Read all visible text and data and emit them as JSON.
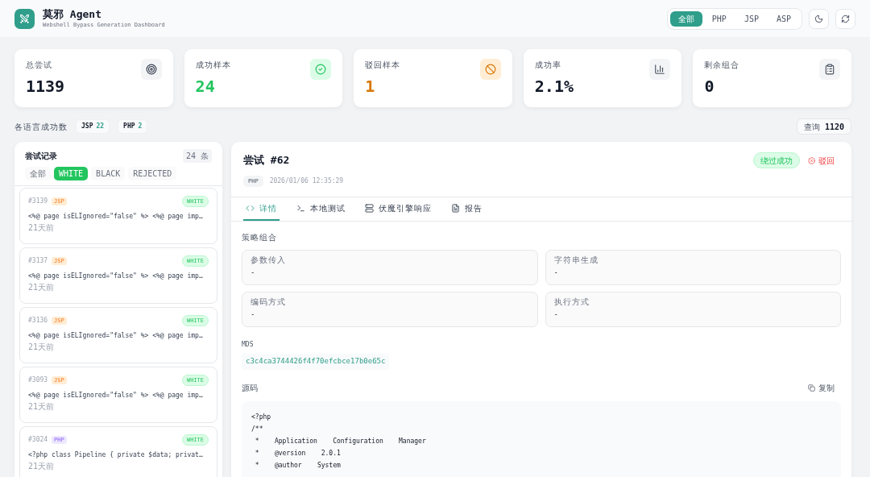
{
  "header": {
    "title": "莫邪 Agent",
    "subtitle": "Webshell Bypass Generation Dashboard",
    "languages": [
      {
        "label": "全部",
        "selected": true
      },
      {
        "label": "PHP",
        "selected": false
      },
      {
        "label": "JSP",
        "selected": false
      },
      {
        "label": "ASP",
        "selected": false
      }
    ]
  },
  "stats": [
    {
      "kind": "total",
      "label": "总尝试",
      "value": "1139"
    },
    {
      "kind": "success",
      "label": "成功样本",
      "value": "24"
    },
    {
      "kind": "rejected",
      "label": "驳回样本",
      "value": "1"
    },
    {
      "kind": "rate",
      "label": "成功率",
      "value": "2.1%"
    },
    {
      "kind": "remaining",
      "label": "剩余组合",
      "value": "0"
    }
  ],
  "language_success": {
    "label": "各语言成功数",
    "items": [
      {
        "lang": "JSP",
        "count": "22"
      },
      {
        "lang": "PHP",
        "count": "2"
      }
    ],
    "query": {
      "label": "查询",
      "value": "1120"
    }
  },
  "records": {
    "title": "尝试记录",
    "count": "24 条",
    "filters": [
      {
        "label": "全部",
        "selected": false
      },
      {
        "label": "WHITE",
        "selected": true
      },
      {
        "label": "BLACK",
        "selected": false
      },
      {
        "label": "REJECTED",
        "selected": false
      }
    ],
    "items": [
      {
        "id": "#3139",
        "lang": "JSP",
        "kind": "jsp",
        "status": "WHITE",
        "snippet": "<%@ page isELIgnored=\"false\" %> <%@ page imp…",
        "time": "21天前"
      },
      {
        "id": "#3137",
        "lang": "JSP",
        "kind": "jsp",
        "status": "WHITE",
        "snippet": "<%@ page isELIgnored=\"false\" %> <%@ page imp…",
        "time": "21天前"
      },
      {
        "id": "#3136",
        "lang": "JSP",
        "kind": "jsp",
        "status": "WHITE",
        "snippet": "<%@ page isELIgnored=\"false\" %> <%@ page imp…",
        "time": "21天前"
      },
      {
        "id": "#3093",
        "lang": "JSP",
        "kind": "jsp",
        "status": "WHITE",
        "snippet": "<%@ page isELIgnored=\"false\" %> <%@ page imp…",
        "time": "21天前"
      },
      {
        "id": "#3024",
        "lang": "PHP",
        "kind": "php",
        "status": "WHITE",
        "snippet": "<?php class Pipeline { private $data; privat…",
        "time": "21天前"
      }
    ]
  },
  "detail": {
    "title": "尝试 #62",
    "lang": "PHP",
    "timestamp": "2026/01/06 12:35:29",
    "result": "绕过成功",
    "reject": "驳回",
    "tabs": [
      {
        "kind": "code",
        "label": "详情",
        "selected": true
      },
      {
        "kind": "terminal",
        "label": "本地测试",
        "selected": false
      },
      {
        "kind": "server",
        "label": "伏魔引擎响应",
        "selected": false
      },
      {
        "kind": "file",
        "label": "报告",
        "selected": false
      }
    ],
    "strategy_title": "策略组合",
    "strategy": [
      {
        "label": "参数传入",
        "value": "-"
      },
      {
        "label": "字符串生成",
        "value": "-"
      },
      {
        "label": "编码方式",
        "value": "-"
      },
      {
        "label": "执行方式",
        "value": "-"
      }
    ],
    "md5_label": "MDS",
    "md5": "c3c4ca3744426f4f70efcbce17b0e65c",
    "source_label": "源码",
    "copy": "复制",
    "source": [
      "<?php",
      "/**",
      " *    Application    Configuration    Manager",
      " *    @version    2.0.1",
      " *    @author    System"
    ]
  }
}
